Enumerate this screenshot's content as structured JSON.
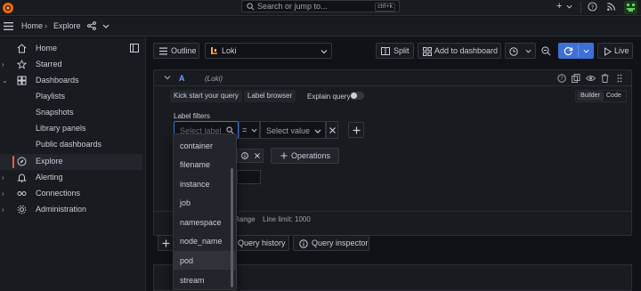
{
  "topbar": {
    "search_placeholder": "Search or jump to...",
    "search_shortcut": "ctrl+k",
    "plus_label": "+"
  },
  "breadcrumb": {
    "home": "Home",
    "separator": "›",
    "current": "Explore"
  },
  "sidebar": {
    "items": [
      {
        "label": "Home",
        "icon": "home-icon"
      },
      {
        "label": "Starred",
        "icon": "star-icon"
      },
      {
        "label": "Dashboards",
        "icon": "dashboards-icon"
      },
      {
        "label": "Playlists"
      },
      {
        "label": "Snapshots"
      },
      {
        "label": "Library panels"
      },
      {
        "label": "Public dashboards"
      },
      {
        "label": "Explore",
        "icon": "compass-icon"
      },
      {
        "label": "Alerting",
        "icon": "bell-icon"
      },
      {
        "label": "Connections",
        "icon": "connections-icon"
      },
      {
        "label": "Administration",
        "icon": "gear-icon"
      }
    ]
  },
  "toolbar": {
    "outline": "Outline",
    "datasource": "Loki",
    "split": "Split",
    "add_to_dashboard": "Add to dashboard",
    "live": "Live"
  },
  "query": {
    "name": "A",
    "datasource": "(Loki)",
    "kick_start": "Kick start your query",
    "label_browser": "Label browser",
    "explain_query": "Explain query",
    "mode_builder": "Builder",
    "mode_code": "Code",
    "label_filters_title": "Label filters",
    "select_label_placeholder": "Select label",
    "operator": "=",
    "select_value_placeholder": "Select value",
    "operations": "Operations",
    "options_range": "Range",
    "options_line_limit": "Line limit: 1000"
  },
  "bottom": {
    "query_history": "Query history",
    "query_inspector": "Query inspector"
  },
  "dropdown": {
    "options": [
      "container",
      "filename",
      "instance",
      "job",
      "namespace",
      "node_name",
      "pod",
      "stream"
    ],
    "highlighted": "pod"
  },
  "colors": {
    "accent": "#3d71d9",
    "active_bar": "#f55f3e",
    "background": "#111217",
    "panel": "#181b1f"
  }
}
